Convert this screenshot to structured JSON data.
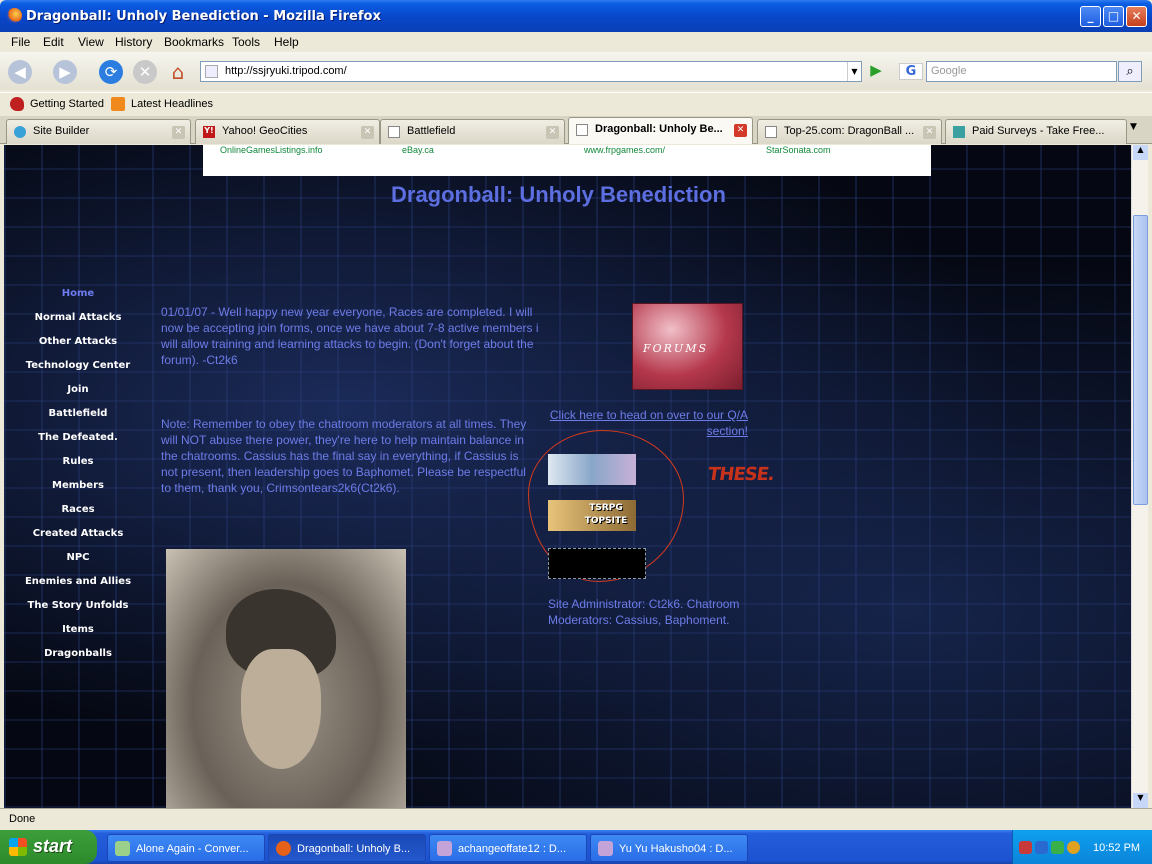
{
  "window": {
    "title": "Dragonball: Unholy Benediction - Mozilla Firefox"
  },
  "menu": [
    "File",
    "Edit",
    "View",
    "History",
    "Bookmarks",
    "Tools",
    "Help"
  ],
  "nav": {
    "url": "http://ssjryuki.tripod.com/",
    "search_placeholder": "Google"
  },
  "bookmarks": [
    "Getting Started",
    "Latest Headlines"
  ],
  "tabs": [
    {
      "label": "Site Builder",
      "active": false
    },
    {
      "label": "Yahoo! GeoCities",
      "active": false
    },
    {
      "label": "Battlefield",
      "active": false
    },
    {
      "label": "Dragonball: Unholy Be...",
      "active": true
    },
    {
      "label": "Top-25.com: DragonBall ...",
      "active": false
    },
    {
      "label": "Paid Surveys - Take Free...",
      "active": false
    }
  ],
  "ads": [
    "OnlineGamesListings.info",
    "eBay.ca",
    "www.frpgames.com/",
    "StarSonata.com"
  ],
  "page": {
    "title": "Dragonball: Unholy Benediction",
    "nav_items": [
      "Home",
      "Normal Attacks",
      "Other Attacks",
      "Technology Center",
      "Join",
      "Battlefield",
      "The Defeated.",
      "Rules",
      "Members",
      "Races",
      "Created Attacks",
      "NPC",
      "Enemies and Allies",
      "The Story Unfolds",
      "Items",
      "Dragonballs"
    ],
    "news": "01/01/07 - Well happy new year everyone, Races are completed. I will now be accepting join forms, once we have about 7-8 active members i will allow training and learning attacks to begin. (Don't forget about the forum). -Ct2k6",
    "note": "Note: Remember to obey the chatroom moderators at all times. They will NOT abuse there power, they're here to help maintain balance in the chatrooms. Cassius has the final say in everything, if Cassius is not present, then leadership goes to Baphomet. Please be respectful to them, thank you, Crimsontears2k6(Ct2k6).",
    "forums_banner": "FORUMS",
    "qa_link": "Click here to head on over to our Q/A section!",
    "annotation": "THESE.",
    "topsite_banner": "TSRPG TOPSITE",
    "admin": "Site Administrator: Ct2k6. Chatroom Moderators: Cassius, Baphoment."
  },
  "status": "Done",
  "taskbar": {
    "start": "start",
    "items": [
      {
        "label": "Alone Again - Conver...",
        "active": false
      },
      {
        "label": "Dragonball: Unholy B...",
        "active": true
      },
      {
        "label": "achangeoffate12 : D...",
        "active": false
      },
      {
        "label": "Yu Yu Hakusho04 : D...",
        "active": false
      }
    ],
    "clock": "10:52 PM"
  },
  "colors": {
    "title_accent": "#5c6ee0",
    "body_text": "#6d7ce8",
    "annotation": "#c8321a"
  }
}
